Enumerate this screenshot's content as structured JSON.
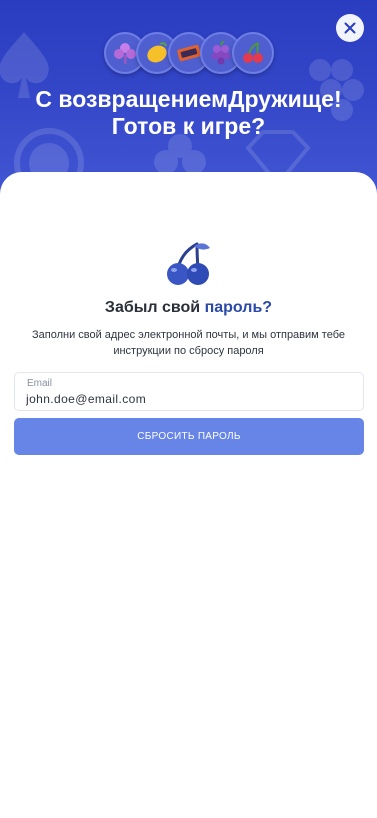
{
  "header": {
    "title_line1": "С возвращениемДружище!",
    "title_line2": "Готов к игре?",
    "badges": [
      "clover-icon",
      "lemon-icon",
      "bar-icon",
      "grapes-icon",
      "cherries-icon"
    ],
    "close_icon": "close-icon"
  },
  "form": {
    "heading_part1": "Забыл свой ",
    "heading_part2": "пароль?",
    "description": "Заполни свой адрес электронной почты, и мы отправим тебе инструкции по сбросу пароля",
    "email_label": "Email",
    "email_value": "john.doe@email.com",
    "submit_label": "СБРОСИТЬ ПАРОЛЬ",
    "illustration": "cherries-icon"
  },
  "colors": {
    "hero_bg": "#3346c8",
    "accent": "#2b4aa8",
    "button": "#6685e7",
    "card": "#ffffff"
  }
}
